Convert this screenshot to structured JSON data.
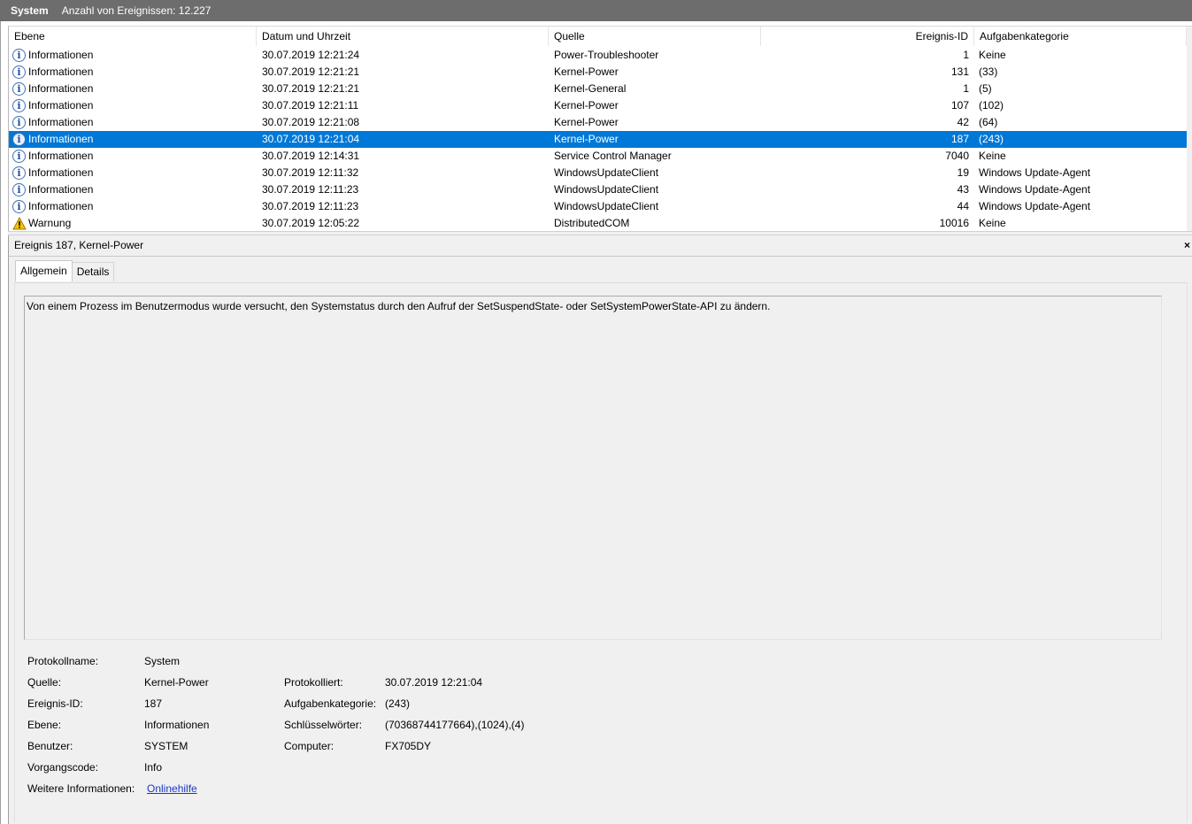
{
  "titlebar": {
    "log_name": "System",
    "count_text": "Anzahl von Ereignissen: 12.227"
  },
  "list": {
    "columns": {
      "level": "Ebene",
      "date": "Datum und Uhrzeit",
      "source": "Quelle",
      "event_id": "Ereignis-ID",
      "task": "Aufgabenkategorie"
    },
    "rows": [
      {
        "level": "Informationen",
        "icon": "info-icon",
        "date": "30.07.2019 12:21:24",
        "source": "Power-Troubleshooter",
        "event_id": "1",
        "task": "Keine"
      },
      {
        "level": "Informationen",
        "icon": "info-icon",
        "date": "30.07.2019 12:21:21",
        "source": "Kernel-Power",
        "event_id": "131",
        "task": "(33)"
      },
      {
        "level": "Informationen",
        "icon": "info-icon",
        "date": "30.07.2019 12:21:21",
        "source": "Kernel-General",
        "event_id": "1",
        "task": "(5)"
      },
      {
        "level": "Informationen",
        "icon": "info-icon",
        "date": "30.07.2019 12:21:11",
        "source": "Kernel-Power",
        "event_id": "107",
        "task": "(102)"
      },
      {
        "level": "Informationen",
        "icon": "info-icon",
        "date": "30.07.2019 12:21:08",
        "source": "Kernel-Power",
        "event_id": "42",
        "task": "(64)"
      },
      {
        "level": "Informationen",
        "icon": "info-icon",
        "date": "30.07.2019 12:21:04",
        "source": "Kernel-Power",
        "event_id": "187",
        "task": "(243)",
        "selected": true
      },
      {
        "level": "Informationen",
        "icon": "info-icon",
        "date": "30.07.2019 12:14:31",
        "source": "Service Control Manager",
        "event_id": "7040",
        "task": "Keine"
      },
      {
        "level": "Informationen",
        "icon": "info-icon",
        "date": "30.07.2019 12:11:32",
        "source": "WindowsUpdateClient",
        "event_id": "19",
        "task": "Windows Update-Agent"
      },
      {
        "level": "Informationen",
        "icon": "info-icon",
        "date": "30.07.2019 12:11:23",
        "source": "WindowsUpdateClient",
        "event_id": "43",
        "task": "Windows Update-Agent"
      },
      {
        "level": "Informationen",
        "icon": "info-icon",
        "date": "30.07.2019 12:11:23",
        "source": "WindowsUpdateClient",
        "event_id": "44",
        "task": "Windows Update-Agent"
      },
      {
        "level": "Warnung",
        "icon": "warning-icon",
        "date": "30.07.2019 12:05:22",
        "source": "DistributedCOM",
        "event_id": "10016",
        "task": "Keine"
      }
    ],
    "selection_color": "#0078d7"
  },
  "detail": {
    "title": "Ereignis 187, Kernel-Power",
    "close_glyph": "×",
    "tabs": {
      "general": "Allgemein",
      "details": "Details"
    },
    "description": "Von einem Prozess im Benutzermodus wurde versucht, den Systemstatus durch den Aufruf der SetSuspendState- oder SetSystemPowerState-API zu ändern.",
    "props": {
      "log_name_label": "Protokollname:",
      "log_name": "System",
      "source_label": "Quelle:",
      "source": "Kernel-Power",
      "logged_label": "Protokolliert:",
      "logged": "30.07.2019 12:21:04",
      "event_id_label": "Ereignis-ID:",
      "event_id": "187",
      "task_label": "Aufgabenkategorie:",
      "task": "(243)",
      "level_label": "Ebene:",
      "level": "Informationen",
      "keywords_label": "Schlüsselwörter:",
      "keywords": "(70368744177664),(1024),(4)",
      "user_label": "Benutzer:",
      "user": "SYSTEM",
      "computer_label": "Computer:",
      "computer": "FX705DY",
      "opcode_label": "Vorgangscode:",
      "opcode": "Info",
      "more_info_label": "Weitere Informationen:",
      "more_info_link": "Onlinehilfe"
    }
  }
}
